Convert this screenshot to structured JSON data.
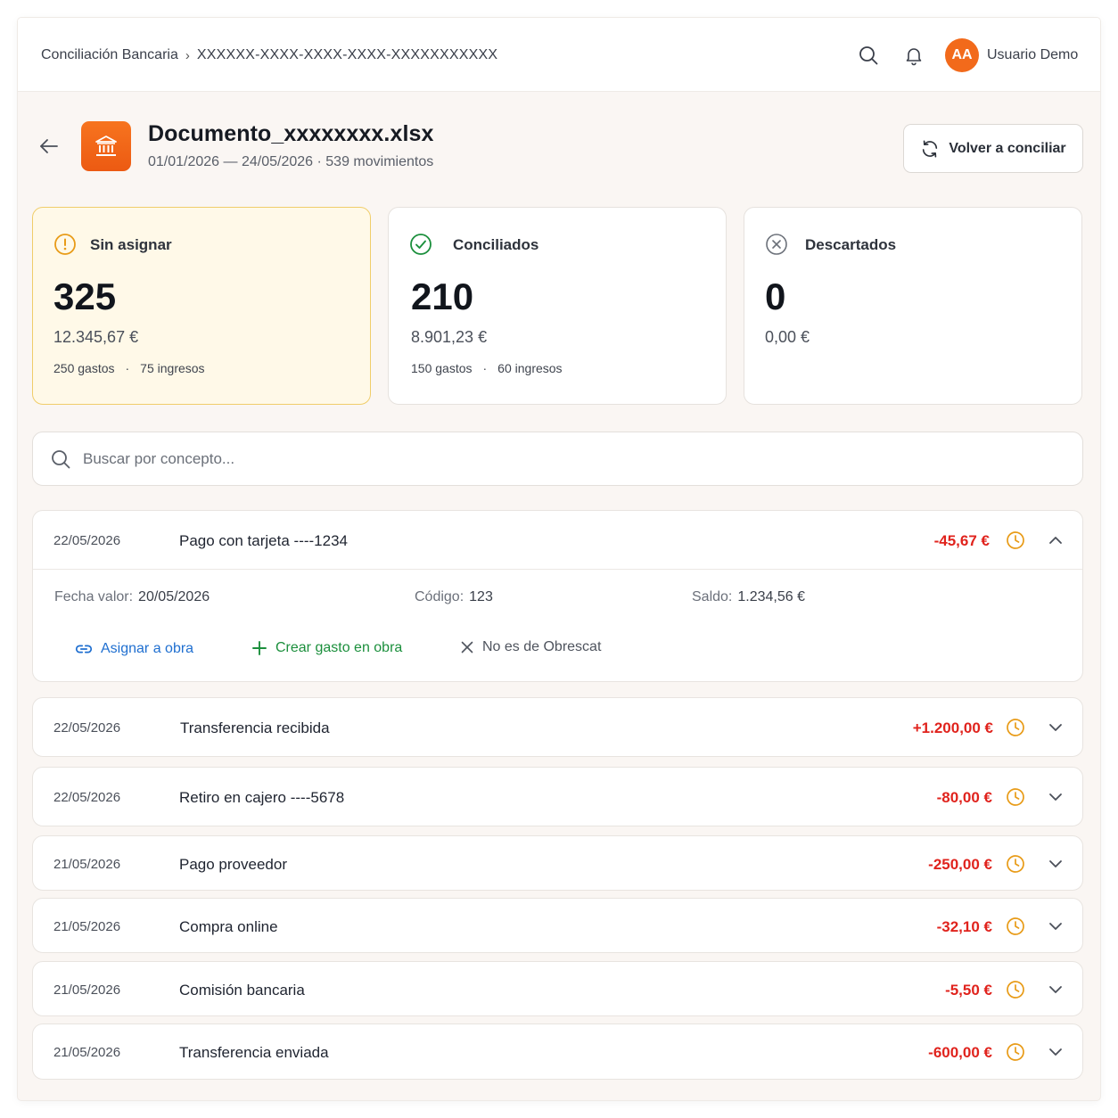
{
  "topbar": {
    "breadcrumb_root": "Conciliación Bancaria",
    "breadcrumb_sep": "›",
    "breadcrumb_id": "XXXXXX-XXXX-XXXX-XXXX-XXXXXXXXXXX",
    "avatar_initials": "AA",
    "user_name": "Usuario Demo",
    "icons": [
      "search-icon",
      "bell-icon"
    ]
  },
  "header": {
    "title": "Documento_xxxxxxxx.xlsx",
    "meta": "01/01/2026 — 24/05/2026 · 539 movimientos",
    "reconcile_label": "Volver a conciliar",
    "accent": "#f26a1b"
  },
  "cards": [
    {
      "title": "Sin asignar",
      "count": "325",
      "amount": "12.345,67 €",
      "expenses": "250 gastos",
      "dot": "·",
      "incomes": "75 ingresos",
      "icon": "alert-circle-icon",
      "color": "#e89b17"
    },
    {
      "title": "Conciliados",
      "count": "210",
      "amount": "8.901,23 €",
      "expenses": "150 gastos",
      "dot": "·",
      "incomes": "60 ingresos",
      "icon": "check-circle-icon",
      "color": "#1b8f3c"
    },
    {
      "title": "Descartados",
      "count": "0",
      "amount": "0,00 €",
      "icon": "x-circle-icon",
      "color": "#6b7079"
    }
  ],
  "search": {
    "placeholder": "Buscar por concepto..."
  },
  "transactions": [
    {
      "date": "22/05/2026",
      "concept": "Pago con tarjeta ----1234",
      "amount": "-45,67 €",
      "expanded": true
    },
    {
      "date": "22/05/2026",
      "concept": "Transferencia recibida",
      "amount": "+1.200,00 €",
      "expanded": false
    },
    {
      "date": "22/05/2026",
      "concept": "Retiro en cajero ----5678",
      "amount": "-80,00 €",
      "expanded": false
    },
    {
      "date": "21/05/2026",
      "concept": "Pago proveedor",
      "amount": "-250,00 €",
      "expanded": false
    },
    {
      "date": "21/05/2026",
      "concept": "Compra online",
      "amount": "-32,10 €",
      "expanded": false
    },
    {
      "date": "21/05/2026",
      "concept": "Comisión bancaria",
      "amount": "-5,50 €",
      "expanded": false
    },
    {
      "date": "21/05/2026",
      "concept": "Transferencia enviada",
      "amount": "-600,00 €",
      "expanded": false
    }
  ],
  "detail": {
    "fecha_label": "Fecha valor:",
    "fecha_value": "20/05/2026",
    "codigo_label": "Código:",
    "codigo_value": "123",
    "saldo_label": "Saldo:",
    "saldo_value": "1.234,56 €",
    "actions": {
      "assign": "Asignar a obra",
      "create": "Crear gasto en obra",
      "dismiss": "No es de Obrescat"
    }
  },
  "colors": {
    "negative": "#e0231d",
    "pending": "#e89b17",
    "link": "#1f6fd0",
    "success": "#1b8f3c"
  }
}
